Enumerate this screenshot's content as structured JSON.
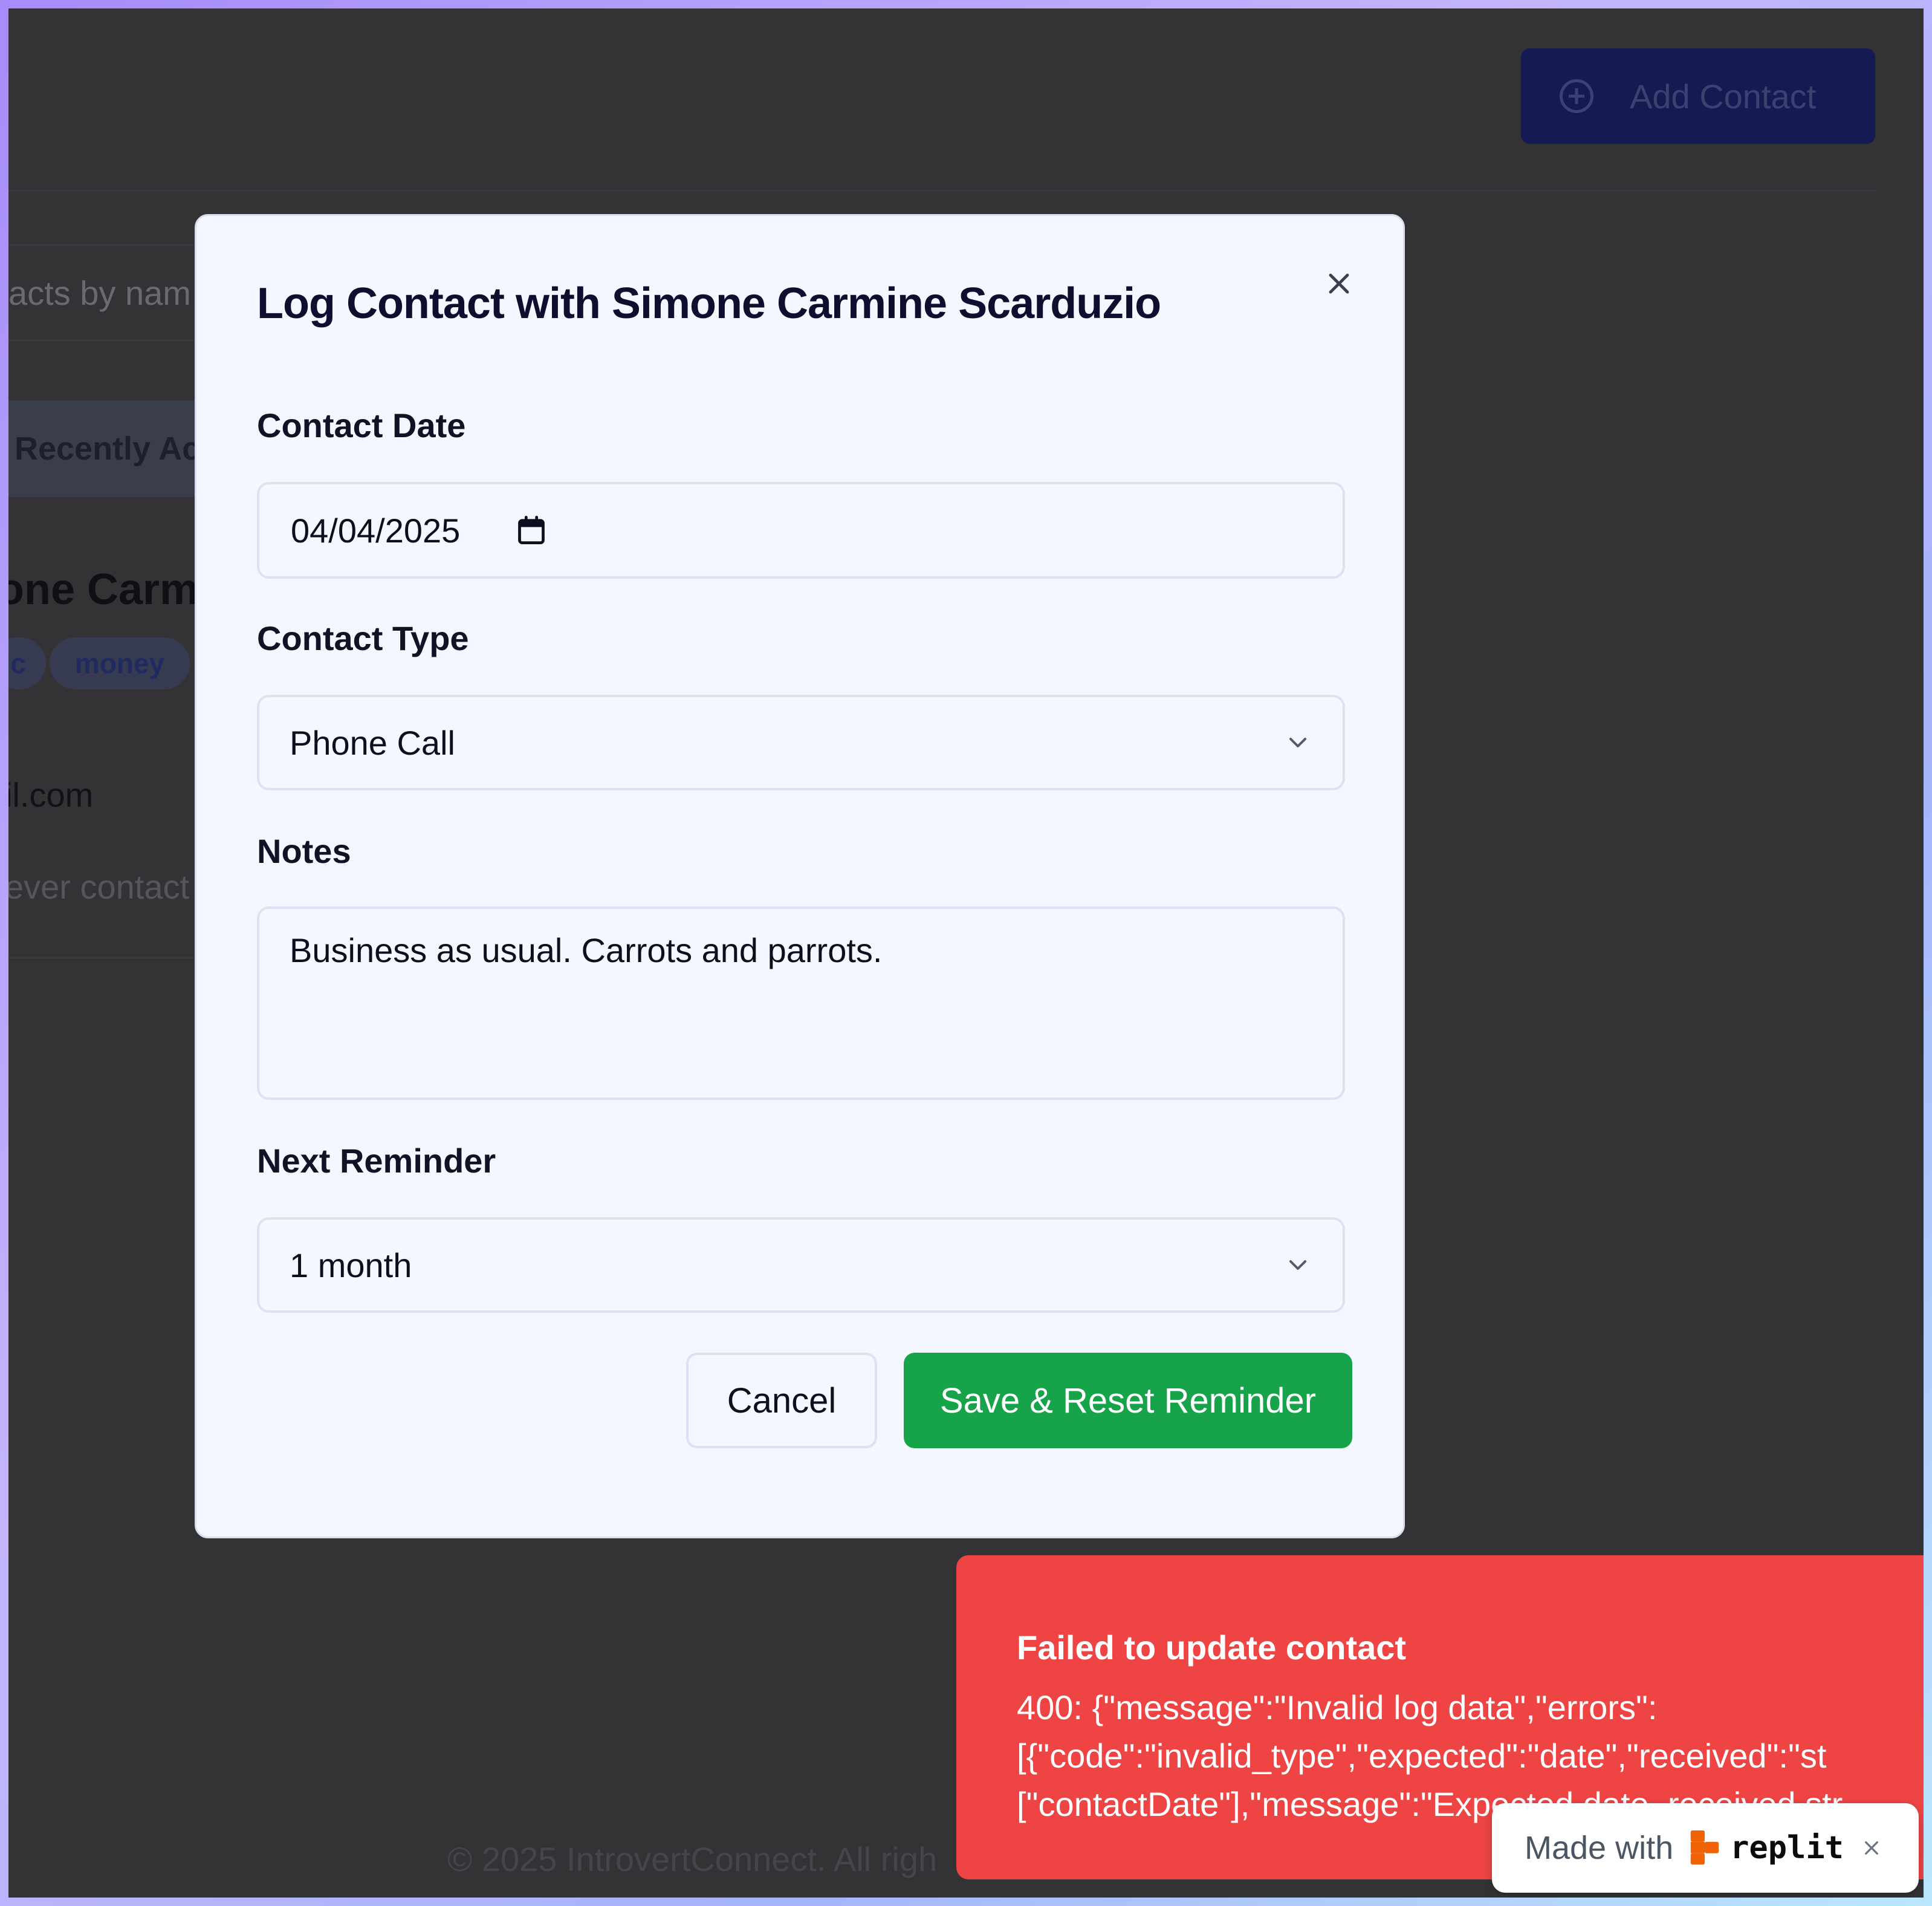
{
  "background": {
    "add_contact_label": "Add Contact",
    "search_placeholder": "acts by nam",
    "tab_label": "Recently Ac",
    "contact_name": "one Carmi",
    "tags": [
      "c",
      "money"
    ],
    "email": "il.com",
    "last_contact": "ever contact",
    "footer": "© 2025 IntrovertConnect. All righ"
  },
  "modal": {
    "title": "Log Contact with Simone Carmine Scarduzio",
    "contact_date_label": "Contact Date",
    "contact_date_value": "04/04/2025",
    "contact_type_label": "Contact Type",
    "contact_type_value": "Phone Call",
    "notes_label": "Notes",
    "notes_value": "Business as usual. Carrots and parrots.",
    "next_reminder_label": "Next Reminder",
    "next_reminder_value": "1 month",
    "cancel_label": "Cancel",
    "save_label": "Save & Reset Reminder"
  },
  "toast": {
    "title": "Failed to update contact",
    "body_lines": [
      "400: {\"message\":\"Invalid log data\",\"errors\":",
      "[{\"code\":\"invalid_type\",\"expected\":\"date\",\"received\":\"st",
      "[\"contactDate\"],\"message\":\"Expected date, received str"
    ]
  },
  "badge": {
    "text": "Made with",
    "brand": "replit"
  },
  "colors": {
    "primary_button": "#16a34a",
    "toast_bg": "#ef4444",
    "modal_bg": "#f4f7ff",
    "overlay": "#333336"
  },
  "icons": [
    "plus-circle-icon",
    "close-icon",
    "calendar-icon",
    "chevron-down-icon",
    "replit-logo-icon"
  ]
}
